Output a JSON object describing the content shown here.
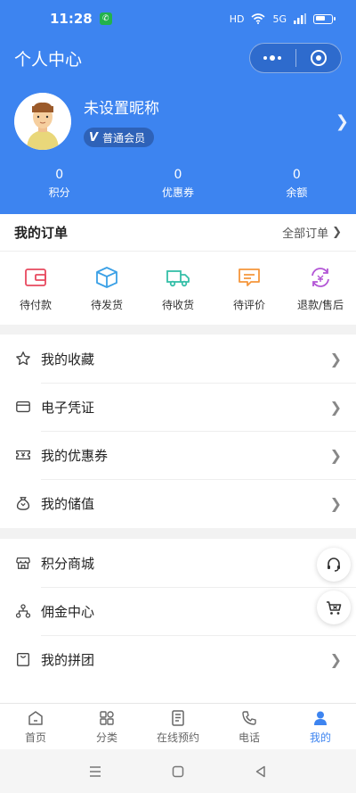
{
  "status": {
    "time": "11:28",
    "indicators": "HD",
    "signal": "5G"
  },
  "navbar": {
    "title": "个人中心"
  },
  "profile": {
    "nickname": "未设置昵称",
    "member_label": "普通会员",
    "member_badge": "V"
  },
  "stats": [
    {
      "value": "0",
      "label": "积分"
    },
    {
      "value": "0",
      "label": "优惠券"
    },
    {
      "value": "0",
      "label": "余额"
    }
  ],
  "orders": {
    "title": "我的订单",
    "all_label": "全部订单",
    "items": [
      {
        "label": "待付款",
        "icon": "wallet-icon",
        "color": "#e8495f"
      },
      {
        "label": "待发货",
        "icon": "box-icon",
        "color": "#3aa0e6"
      },
      {
        "label": "待收货",
        "icon": "truck-icon",
        "color": "#35bfa8"
      },
      {
        "label": "待评价",
        "icon": "comment-icon",
        "color": "#f5963b"
      },
      {
        "label": "退款/售后",
        "icon": "refund-icon",
        "color": "#b356d6"
      }
    ]
  },
  "menu1": [
    {
      "label": "我的收藏",
      "icon": "star-icon"
    },
    {
      "label": "电子凭证",
      "icon": "card-icon"
    },
    {
      "label": "我的优惠券",
      "icon": "ticket-icon"
    },
    {
      "label": "我的储值",
      "icon": "moneybag-icon"
    }
  ],
  "menu2": [
    {
      "label": "积分商城",
      "icon": "store-icon"
    },
    {
      "label": "佣金中心",
      "icon": "network-icon"
    },
    {
      "label": "我的拼团",
      "icon": "bag-icon"
    }
  ],
  "tabs": [
    {
      "label": "首页",
      "icon": "home-icon"
    },
    {
      "label": "分类",
      "icon": "grid-icon"
    },
    {
      "label": "在线预约",
      "icon": "document-icon"
    },
    {
      "label": "电话",
      "icon": "phone-icon"
    },
    {
      "label": "我的",
      "icon": "user-icon",
      "active": true
    }
  ],
  "colors": {
    "primary": "#3d84f0",
    "member_badge_bg": "#2e62b8"
  }
}
